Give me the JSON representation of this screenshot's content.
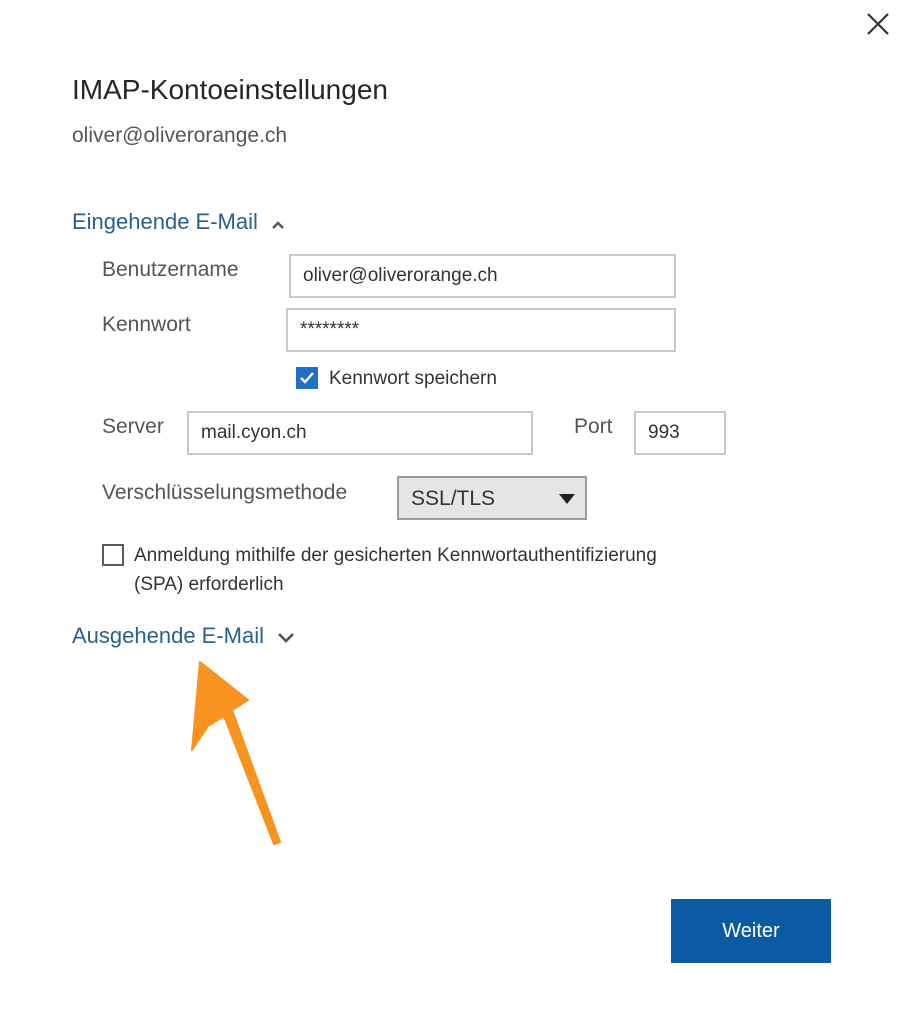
{
  "dialog": {
    "title": "IMAP-Kontoeinstellungen",
    "account": "oliver@oliverorange.ch",
    "close_icon": "close-icon"
  },
  "incoming": {
    "header": "Eingehende E-Mail",
    "chevron_icon": "chevron-up-icon",
    "username_label": "Benutzername",
    "username_value": "oliver@oliverorange.ch",
    "password_label": "Kennwort",
    "password_value": "********",
    "remember_password_label": "Kennwort speichern",
    "remember_password_checked": true,
    "server_label": "Server",
    "server_value": "mail.cyon.ch",
    "port_label": "Port",
    "port_value": "993",
    "encryption_label": "Verschlüsselungsmethode",
    "encryption_value": "SSL/TLS",
    "spa_label_line1": "Anmeldung mithilfe der gesicherten Kennwortauthentifizierung",
    "spa_label_line2": "(SPA) erforderlich",
    "spa_checked": false
  },
  "outgoing": {
    "header": "Ausgehende E-Mail",
    "chevron_icon": "chevron-down-icon"
  },
  "annotation": {
    "arrow_icon": "arrow-up-icon",
    "arrow_color": "#f7931e"
  },
  "footer": {
    "next_label": "Weiter"
  },
  "colors": {
    "accent": "#0b5aa3",
    "link": "#2b5f8e",
    "checkbox": "#1f6fc5"
  }
}
